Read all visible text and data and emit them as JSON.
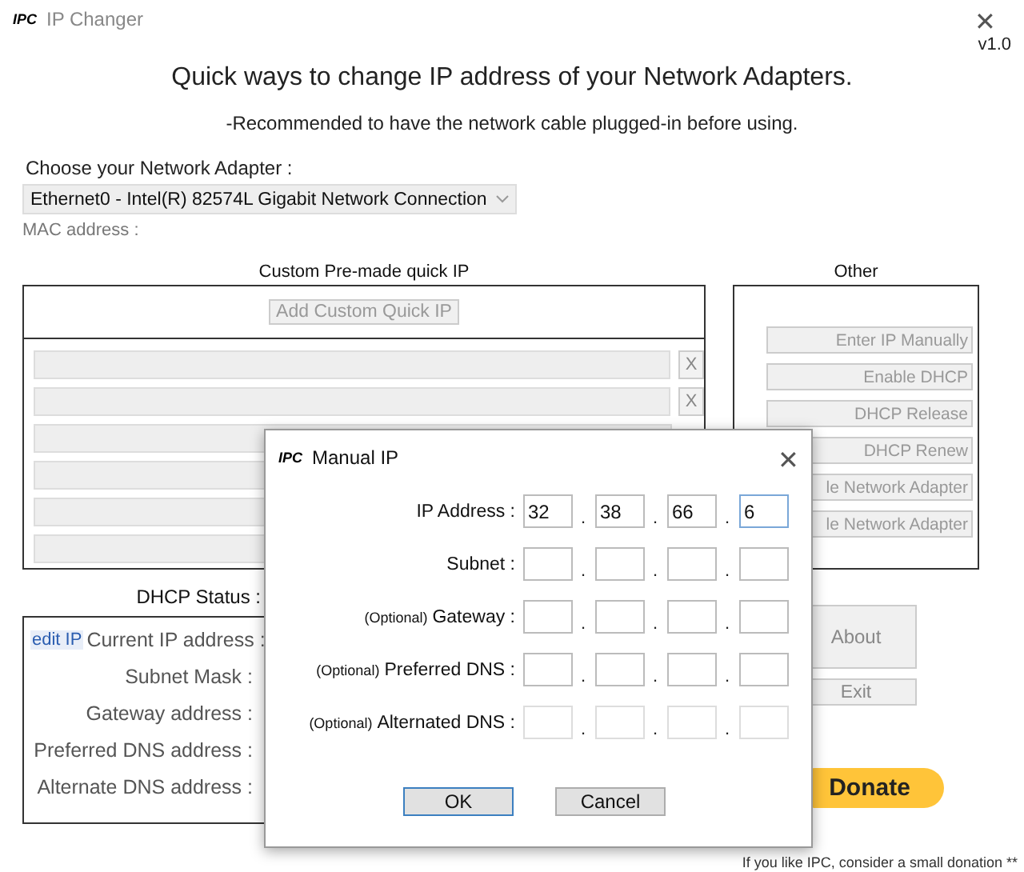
{
  "window": {
    "logo": "IPC",
    "title": "IP Changer",
    "close": "✕",
    "version": "v1.0"
  },
  "heading": "Quick ways to change IP address of your Network Adapters.",
  "note": "-Recommended to have the network cable plugged-in before using.",
  "adapter": {
    "label": "Choose your Network Adapter :",
    "value": "Ethernet0 - Intel(R) 82574L Gigabit Network Connection",
    "mac_label": "MAC address :"
  },
  "custom_quick_ip": {
    "title": "Custom Pre-made quick IP",
    "add_button": "Add Custom Quick IP",
    "rows": [
      {
        "kind": "with_remove",
        "remove": "X"
      },
      {
        "kind": "with_remove",
        "remove": "X"
      },
      {
        "kind": "field"
      },
      {
        "kind": "field"
      },
      {
        "kind": "field"
      },
      {
        "kind": "field"
      }
    ]
  },
  "other": {
    "title": "Other",
    "buttons": [
      "Enter IP Manually",
      "Enable DHCP",
      "DHCP Release",
      "DHCP Renew",
      "le Network Adapter",
      "le Network Adapter"
    ]
  },
  "dhcp_status": {
    "label": "DHCP Status :",
    "edit_link": "edit IP",
    "fields": [
      "Current IP address :",
      "Subnet Mask :",
      "Gateway address :",
      "Preferred DNS address :",
      "Alternate DNS address :"
    ]
  },
  "about_button": "About",
  "exit_button": "Exit",
  "donate": {
    "button": "Donate",
    "note": "If you like IPC, consider a small donation **"
  },
  "dialog": {
    "logo": "IPC",
    "title": "Manual IP",
    "close": "✕",
    "separator": ".",
    "rows": [
      {
        "label": "IP Address :",
        "disabled": false,
        "octets": [
          {
            "value": "32",
            "focused": false
          },
          {
            "value": "38",
            "focused": false
          },
          {
            "value": "66",
            "focused": false
          },
          {
            "value": "6",
            "focused": true
          }
        ]
      },
      {
        "label": "Subnet :",
        "disabled": false
      },
      {
        "prefix": "(Optional)",
        "label": "Gateway :",
        "disabled": false
      },
      {
        "prefix": "(Optional)",
        "label": "Preferred DNS :",
        "disabled": false
      },
      {
        "prefix": "(Optional)",
        "label": "Alternated DNS :",
        "disabled": true
      }
    ],
    "ok": "OK",
    "cancel": "Cancel"
  }
}
